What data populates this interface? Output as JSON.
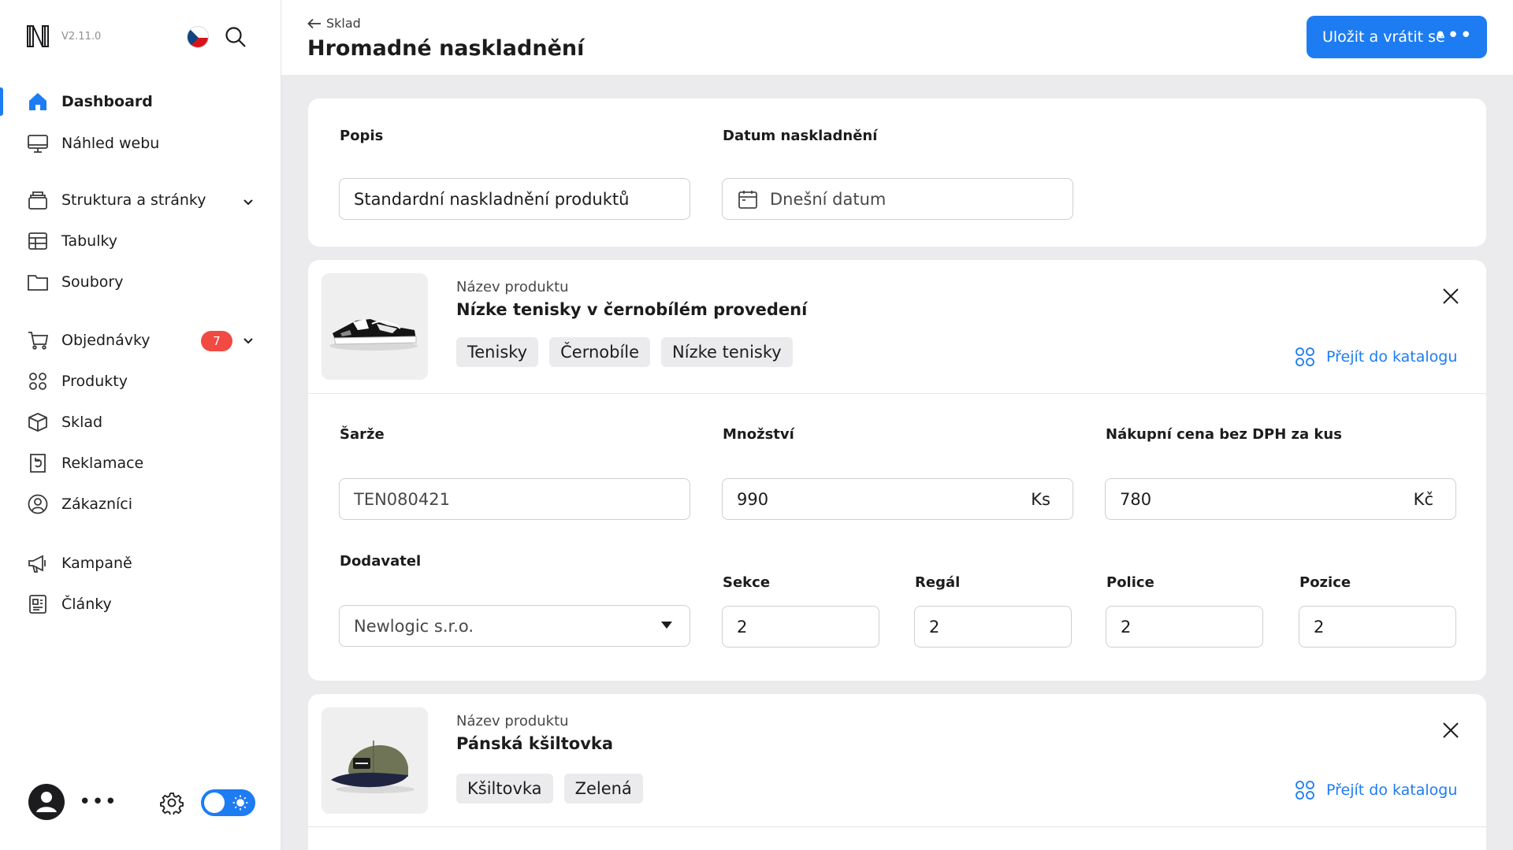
{
  "app": {
    "version": "V2.11.0",
    "accent": "#1e7cf2"
  },
  "sidebar": {
    "items": [
      {
        "label": "Dashboard",
        "icon": "home-icon",
        "active": true
      },
      {
        "label": "Náhled webu",
        "icon": "monitor-icon"
      },
      {
        "label": "Struktura a stránky",
        "icon": "layers-icon",
        "expandable": true
      },
      {
        "label": "Tabulky",
        "icon": "table-icon"
      },
      {
        "label": "Soubory",
        "icon": "folder-icon"
      },
      {
        "label": "Objednávky",
        "icon": "cart-icon",
        "badge": "7",
        "expandable": true
      },
      {
        "label": "Produkty",
        "icon": "grid-icon"
      },
      {
        "label": "Sklad",
        "icon": "box-icon"
      },
      {
        "label": "Reklamace",
        "icon": "return-icon"
      },
      {
        "label": "Zákazníci",
        "icon": "user-circle-icon"
      },
      {
        "label": "Kampaně",
        "icon": "megaphone-icon"
      },
      {
        "label": "Články",
        "icon": "article-icon"
      }
    ],
    "footer": {
      "more": "•••"
    }
  },
  "header": {
    "breadcrumb": "Sklad",
    "title": "Hromadné naskladnění",
    "save_label": "Uložit a vrátit se",
    "more": "•••"
  },
  "form": {
    "description_label": "Popis",
    "description_value": "Standardní naskladnění produktů",
    "date_label": "Datum naskladnění",
    "date_placeholder": "Dnešní datum"
  },
  "products": [
    {
      "subtitle": "Název produktu",
      "name": "Nízke tenisky v černobílém provedení",
      "tags": [
        "Tenisky",
        "Černobíle",
        "Nízke tenisky"
      ],
      "catalog_link": "Přejít do katalogu",
      "batch_label": "Šarže",
      "batch_value": "TEN080421",
      "quantity_label": "Množství",
      "quantity_value": "990",
      "quantity_unit": "Ks",
      "price_label": "Nákupní cena bez DPH za kus",
      "price_value": "780",
      "price_unit": "Kč",
      "supplier_label": "Dodavatel",
      "supplier_value": "Newlogic s.r.o.",
      "section_label": "Sekce",
      "section_value": "2",
      "rack_label": "Regál",
      "rack_value": "2",
      "shelf_label": "Police",
      "shelf_value": "2",
      "position_label": "Pozice",
      "position_value": "2"
    },
    {
      "subtitle": "Název produktu",
      "name": "Pánská kšiltovka",
      "tags": [
        "Kšiltovka",
        "Zelená"
      ],
      "catalog_link": "Přejít do katalogu"
    }
  ]
}
